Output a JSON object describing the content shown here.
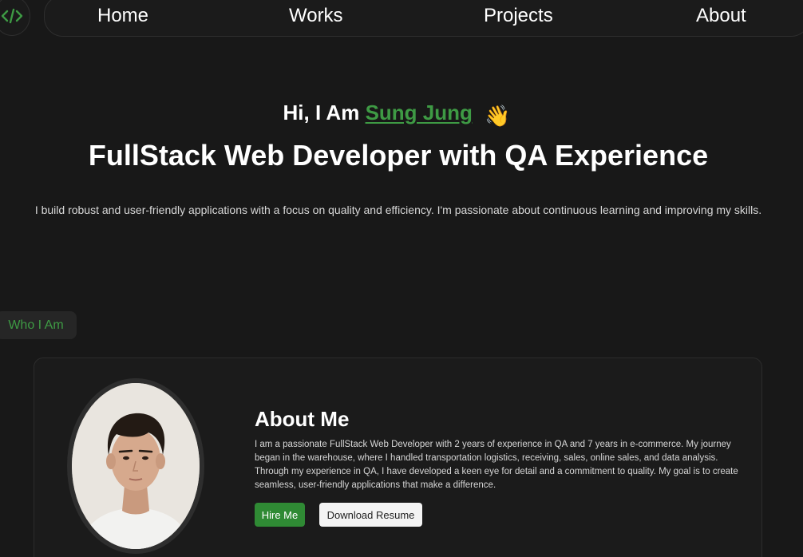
{
  "nav": {
    "logo_icon": "code-icon",
    "items": [
      {
        "label": "Home"
      },
      {
        "label": "Works"
      },
      {
        "label": "Projects"
      },
      {
        "label": "About"
      }
    ]
  },
  "hero": {
    "greeting_prefix": "Hi, I Am",
    "name": "Sung Jung",
    "wave_emoji": "👋",
    "headline": "FullStack Web Developer with QA Experience",
    "intro": "I build robust and user-friendly applications with a focus on quality and efficiency. I'm passionate about continuous learning and improving my skills."
  },
  "section": {
    "tag": "Who I Am"
  },
  "about": {
    "title": "About Me",
    "text": "I am a passionate FullStack Web Developer with 2 years of experience in QA and 7 years in e-commerce. My journey began in the warehouse, where I handled transportation logistics, receiving, sales, online sales, and data analysis. Through my experience in QA, I have developed a keen eye for detail and a commitment to quality. My goal is to create seamless, user-friendly applications that make a difference.",
    "hire_label": "Hire Me",
    "resume_label": "Download Resume"
  },
  "colors": {
    "accent": "#3e9a44",
    "background": "#181818",
    "card": "#1b1b1b"
  }
}
